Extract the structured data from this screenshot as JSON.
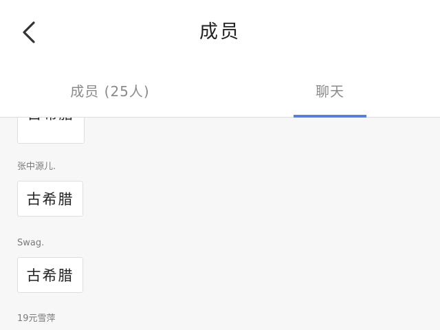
{
  "header": {
    "title": "成员",
    "back_icon": "chevron-left-icon"
  },
  "tabs": [
    {
      "label": "成员 (25人)",
      "active": false
    },
    {
      "label": "聊天",
      "active": true
    }
  ],
  "colors": {
    "accent": "#5b7fd4",
    "background": "#f7f7f7",
    "text": "#222222",
    "muted": "#8a8a8a"
  },
  "chat": {
    "partial_message": "古希腊",
    "messages": [
      {
        "sender": "张中源儿.",
        "text": "古希腊"
      },
      {
        "sender": "Swag.",
        "text": "古希腊"
      },
      {
        "sender": "19元雪萍",
        "text": ""
      }
    ]
  }
}
